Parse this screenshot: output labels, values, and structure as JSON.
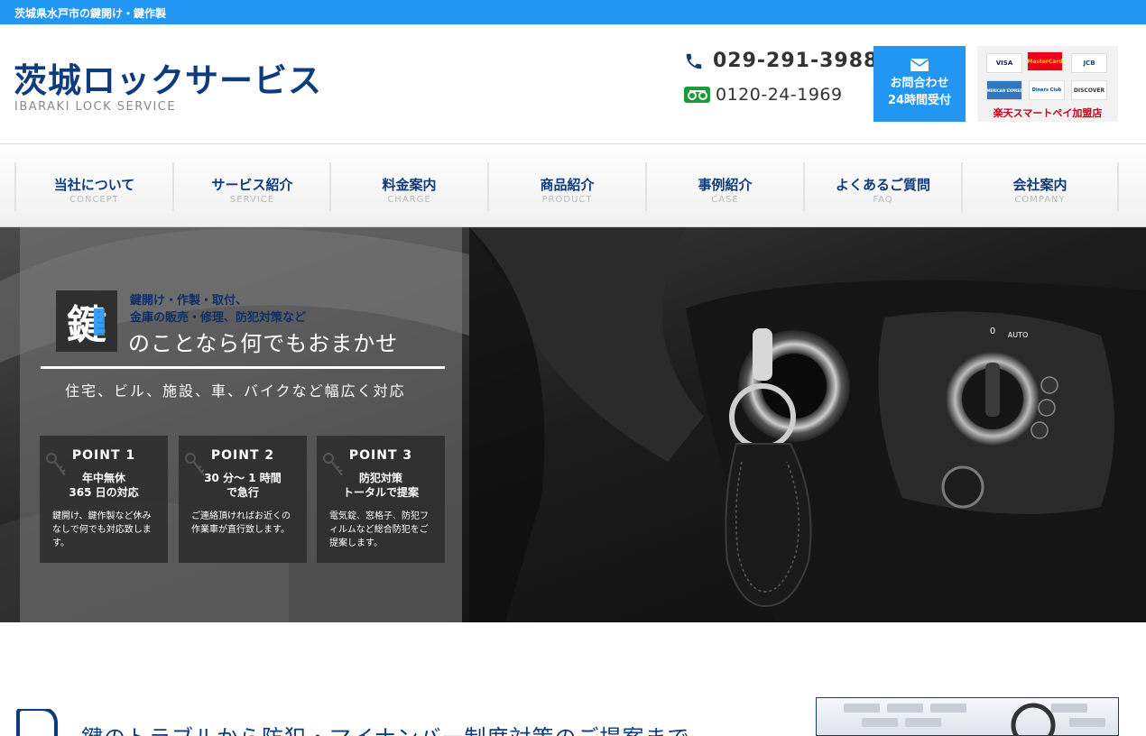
{
  "topbar": {
    "text": "茨城県水戸市の鍵開け・鍵作製"
  },
  "header": {
    "logo_title": "茨城ロックサービス",
    "logo_subtitle": "IBARAKI LOCK SERVICE",
    "phone": "029-291-3988",
    "freedial": "0120-24-1969",
    "contact_line1": "お問合わせ",
    "contact_line2": "24時間受付",
    "cards": [
      "VISA",
      "MasterCard",
      "JCB",
      "AMERICAN EXPRESS",
      "Diners Club",
      "DISCOVER"
    ],
    "rakuten": "楽天スマートペイ加盟店"
  },
  "nav": {
    "items": [
      {
        "label": "当社について",
        "sub": "CONCEPT"
      },
      {
        "label": "サービス紹介",
        "sub": "SERVICE"
      },
      {
        "label": "料金案内",
        "sub": "CHARGE"
      },
      {
        "label": "商品紹介",
        "sub": "PRODUCT"
      },
      {
        "label": "事例紹介",
        "sub": "CASE"
      },
      {
        "label": "よくあるご質問",
        "sub": "FAQ"
      },
      {
        "label": "会社案内",
        "sub": "COMPANY"
      }
    ]
  },
  "hero": {
    "kanji": "鍵",
    "line1": "鍵開け・作製・取付、",
    "line2": "金庫の販売・修理、防犯対策など",
    "tagline": "のことなら何でもおまかせ",
    "scope": "住宅、ビル、施設、車、バイクなど幅広く対応",
    "points": [
      {
        "title": "POINT 1",
        "head1": "年中無休",
        "head2": "365 日の対応",
        "body": "鍵開け、鍵作製など休みなしで何でも対応致します。"
      },
      {
        "title": "POINT 2",
        "head1": "30 分～ 1 時間",
        "head2": "で急行",
        "body": "ご連絡頂ければお近くの作業車が直行致します。"
      },
      {
        "title": "POINT 3",
        "head1": "防犯対策",
        "head2": "トータルで提案",
        "body": "電気錠、窓格子、防犯フィルムなど総合防犯をご提案します。"
      }
    ]
  },
  "section": {
    "title": "鍵のトラブルから防犯・マイナンバー制度対策のご提案まで"
  },
  "colors": {
    "accent": "#2196f3",
    "brand_navy": "#0d3b7d",
    "freedial_green": "#1a9c3a",
    "rakuten_red": "#c4001a"
  }
}
